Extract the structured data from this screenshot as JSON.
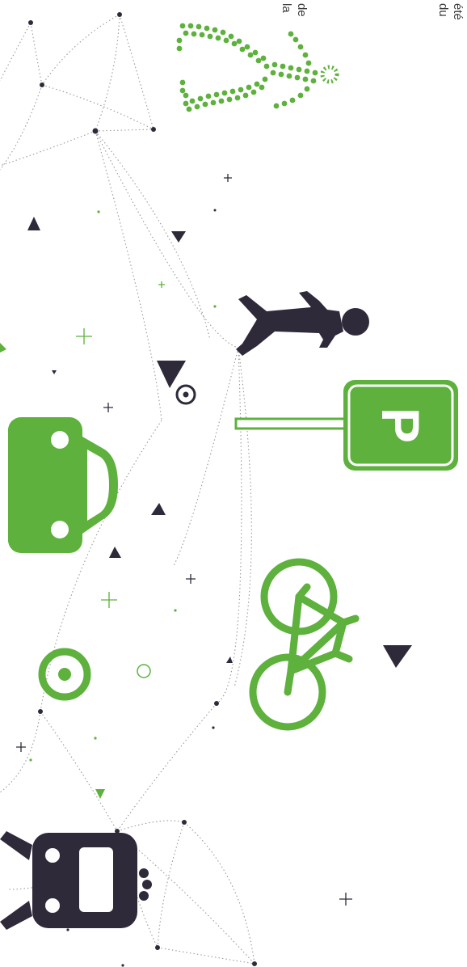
{
  "text_fragments": [
    "été",
    "du",
    "de",
    "la"
  ],
  "parking_letter": "P",
  "colors": {
    "accent": "#5db13c",
    "dark": "#2f2a3a",
    "line": "#9a9a9a"
  },
  "icons": [
    "dotted-pedestrian-icon",
    "pedestrian-icon",
    "parking-sign-icon",
    "car-icon",
    "bicycle-icon",
    "target-icon",
    "train-icon"
  ]
}
